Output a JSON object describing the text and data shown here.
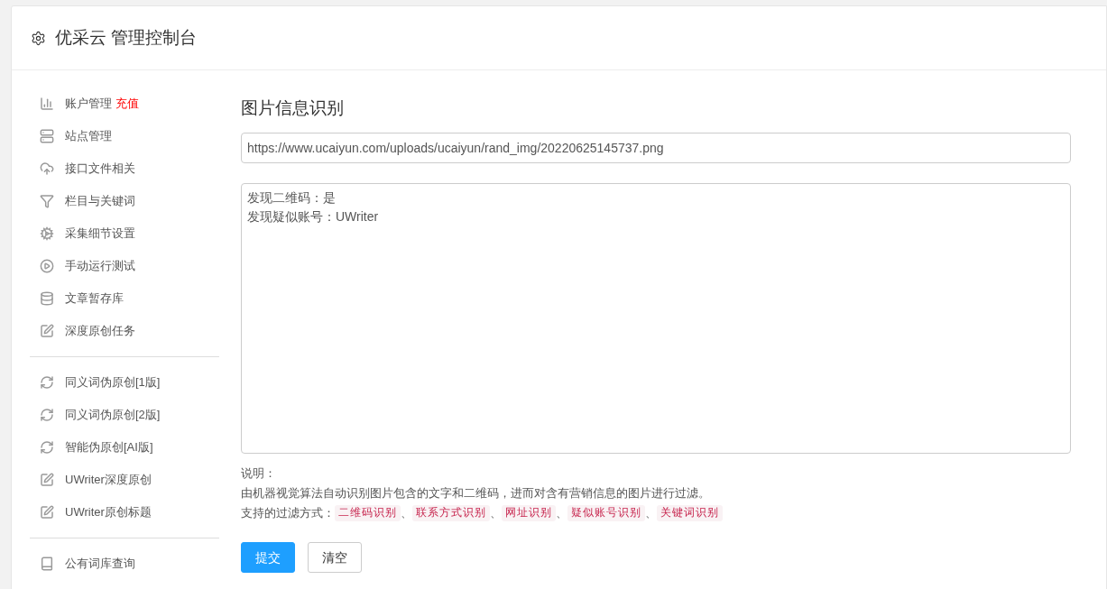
{
  "header": {
    "title": "优采云 管理控制台"
  },
  "sidebar": {
    "groups": [
      {
        "items": [
          {
            "kind": "chart",
            "label": "账户管理",
            "badge": "充值"
          },
          {
            "kind": "server",
            "label": "站点管理"
          },
          {
            "kind": "cloud",
            "label": "接口文件相关"
          },
          {
            "kind": "filter",
            "label": "栏目与关键词"
          },
          {
            "kind": "gears",
            "label": "采集细节设置"
          },
          {
            "kind": "play",
            "label": "手动运行测试"
          },
          {
            "kind": "database",
            "label": "文章暂存库"
          },
          {
            "kind": "edit",
            "label": "深度原创任务"
          }
        ]
      },
      {
        "items": [
          {
            "kind": "refresh",
            "label": "同义词伪原创[1版]"
          },
          {
            "kind": "refresh",
            "label": "同义词伪原创[2版]"
          },
          {
            "kind": "refresh",
            "label": "智能伪原创[AI版]"
          },
          {
            "kind": "edit",
            "label": "UWriter深度原创"
          },
          {
            "kind": "edit",
            "label": "UWriter原创标题"
          }
        ]
      },
      {
        "items": [
          {
            "kind": "book",
            "label": "公有词库查询"
          }
        ]
      }
    ]
  },
  "main": {
    "title": "图片信息识别",
    "url_field": {
      "value": "https://www.ucaiyun.com/uploads/ucaiyun/rand_img/20220625145737.png"
    },
    "result_box": {
      "lines": [
        "发现二维码：是",
        "发现疑似账号：UWriter"
      ]
    },
    "note_label": "说明：",
    "note_text": "由机器视觉算法自动识别图片包含的文字和二维码，进而对含有营销信息的图片进行过滤。",
    "methods_label": "支持的过滤方式：",
    "methods": [
      "二维码识别",
      "联系方式识别",
      "网址识别",
      "疑似账号识别",
      "关键词识别"
    ],
    "separator": "、",
    "buttons": [
      {
        "kind": "primary",
        "label": "提交"
      },
      {
        "kind": "default",
        "label": "清空"
      }
    ]
  }
}
